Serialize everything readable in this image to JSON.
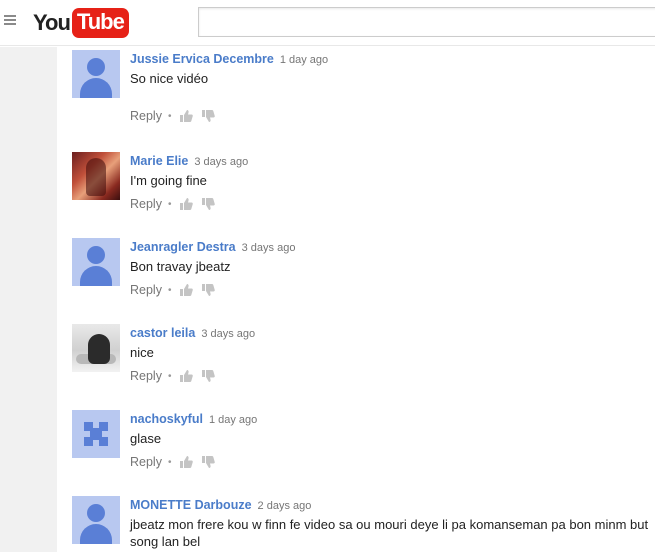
{
  "header": {
    "menu_icon": "hamburger-menu-icon",
    "logo": {
      "you": "You",
      "tube": "Tube"
    },
    "search": {
      "value": "",
      "placeholder": ""
    }
  },
  "comments": [
    {
      "author": "Jussie Ervica Decembre",
      "time": "1 day ago",
      "text": "So nice vidéo",
      "reply_label": "Reply",
      "avatar": "default-avatar"
    },
    {
      "author": "Marie Elie",
      "time": "3 days ago",
      "text": "I'm going fine",
      "reply_label": "Reply",
      "avatar": "photo-avatar"
    },
    {
      "author": "Jeanragler Destra",
      "time": "3 days ago",
      "text": "Bon travay jbeatz",
      "reply_label": "Reply",
      "avatar": "default-avatar"
    },
    {
      "author": "castor leila",
      "time": "3 days ago",
      "text": "nice",
      "reply_label": "Reply",
      "avatar": "photo-avatar"
    },
    {
      "author": "nachoskyful",
      "time": "1 day ago",
      "text": "glase",
      "reply_label": "Reply",
      "avatar": "pattern-avatar"
    },
    {
      "author": "MONETTE Darbouze",
      "time": "2 days ago",
      "text": "jbeatz mon frere kou w finn fe video sa ou mouri deye li pa komanseman pa bon minm but song lan bel",
      "reply_label": "Reply",
      "avatar": "default-avatar"
    }
  ],
  "colors": {
    "author_link": "#4a7cc9",
    "logo_red": "#e62117",
    "avatar_bg": "#b8c8f0",
    "avatar_fg": "#5a7fd6"
  }
}
